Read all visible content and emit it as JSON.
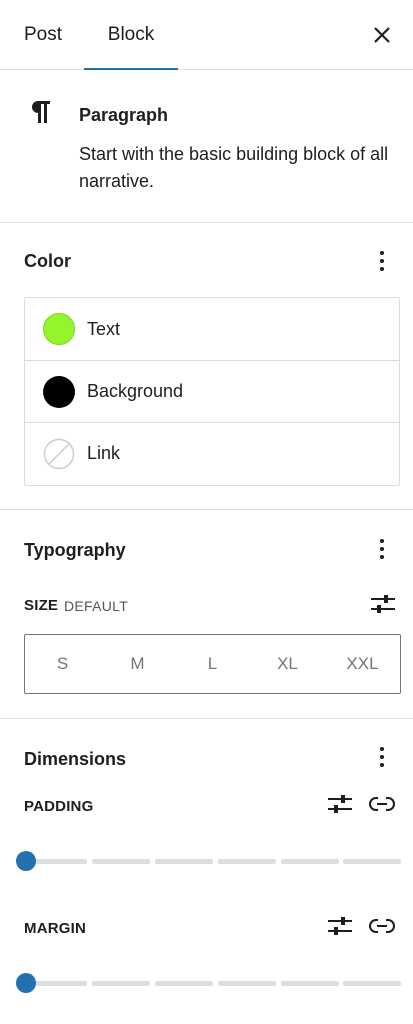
{
  "tabs": {
    "post": "Post",
    "block": "Block",
    "active": "Block"
  },
  "block": {
    "title": "Paragraph",
    "description": "Start with the basic building block of all narrative.",
    "icon": "paragraph-icon"
  },
  "color": {
    "title": "Color",
    "items": [
      {
        "label": "Text",
        "swatch": "#95f52c"
      },
      {
        "label": "Background",
        "swatch": "#000000"
      },
      {
        "label": "Link",
        "swatch": "none"
      }
    ]
  },
  "typography": {
    "title": "Typography",
    "size_label": "SIZE",
    "size_value": "DEFAULT",
    "sizes": [
      "S",
      "M",
      "L",
      "XL",
      "XXL"
    ]
  },
  "dimensions": {
    "title": "Dimensions",
    "padding_label": "PADDING",
    "margin_label": "MARGIN",
    "padding_value": 0,
    "margin_value": 0
  },
  "colors": {
    "accent": "#2271b1",
    "border": "#e0e0e0"
  }
}
